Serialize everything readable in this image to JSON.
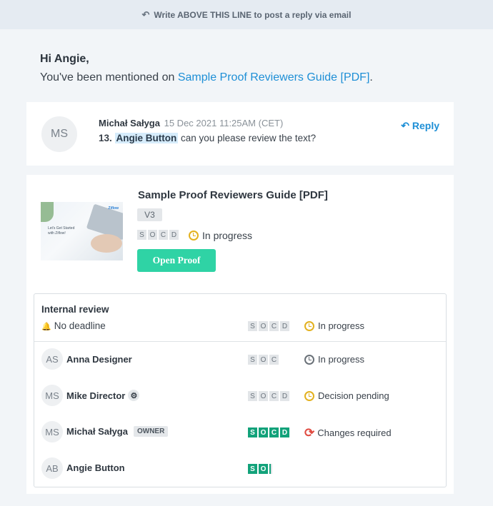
{
  "banner": {
    "text": "Write ABOVE THIS LINE to post a reply via email",
    "icon": "reply-icon"
  },
  "greeting": "Hi Angie,",
  "mention": {
    "prefix": "You've been mentioned on ",
    "link": "Sample Proof Reviewers Guide [PDF]",
    "suffix": "."
  },
  "comment": {
    "avatar": "MS",
    "author": "Michał Sałyga",
    "date": "15 Dec 2021 11:25AM (CET)",
    "number": "13.",
    "tag": "Angie Button",
    "text": " can you please review the text?",
    "reply_label": "Reply",
    "reply_icon": "reply-arrow-icon"
  },
  "proof": {
    "title": "Sample Proof Reviewers Guide [PDF]",
    "version": "V3",
    "stages": [
      "S",
      "O",
      "C",
      "D"
    ],
    "status": "In progress",
    "open_label": "Open Proof",
    "thumbnail": {
      "brand": "Ziflow",
      "title": "Let's Get Started with Ziflow!"
    }
  },
  "review": {
    "title": "Internal review",
    "deadline": "No deadline",
    "stages": [
      "S",
      "O",
      "C",
      "D"
    ],
    "status": "In progress",
    "reviewers": [
      {
        "initials": "AS",
        "name": "Anna Designer",
        "stages": [
          "S",
          "O",
          "C"
        ],
        "status": "In progress",
        "status_icon": "clock-icon"
      },
      {
        "initials": "MS",
        "name": "Mike Director",
        "stages": [
          "S",
          "O",
          "C",
          "D"
        ],
        "status": "Decision pending",
        "status_icon": "clock-icon",
        "badge_icon": "gear-icon"
      },
      {
        "initials": "MS",
        "name": "Michał Sałyga",
        "badge": "OWNER",
        "stages": [
          "S",
          "O",
          "C",
          "D"
        ],
        "status": "Changes required",
        "status_icon": "refresh-icon"
      },
      {
        "initials": "AB",
        "name": "Angie Button",
        "stages": [
          "S",
          "O"
        ],
        "status": ""
      }
    ]
  },
  "colors": {
    "link": "#1e8fd6",
    "accent": "#2fd3a5",
    "stage_done": "#12a27a",
    "pending": "#e3b11f",
    "changes": "#e04b41"
  }
}
